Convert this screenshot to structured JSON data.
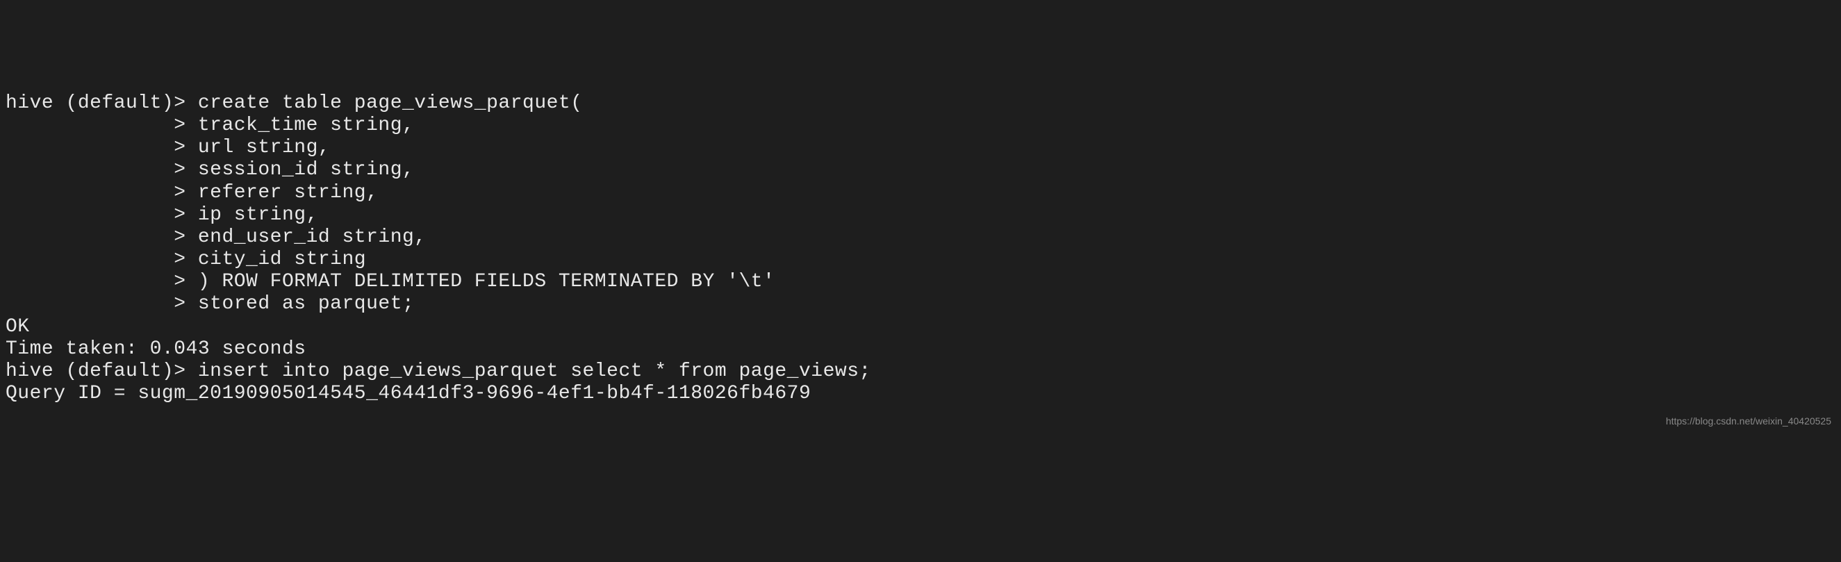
{
  "terminal": {
    "lines": [
      "hive (default)> create table page_views_parquet(",
      "              > track_time string,",
      "              > url string,",
      "              > session_id string,",
      "              > referer string,",
      "              > ip string,",
      "              > end_user_id string,",
      "              > city_id string",
      "              > ) ROW FORMAT DELIMITED FIELDS TERMINATED BY '\\t'",
      "              > stored as parquet;",
      "OK",
      "Time taken: 0.043 seconds",
      "hive (default)> insert into page_views_parquet select * from page_views;",
      "Query ID = sugm_20190905014545_46441df3-9696-4ef1-bb4f-118026fb4679"
    ]
  },
  "watermark": "https://blog.csdn.net/weixin_40420525"
}
